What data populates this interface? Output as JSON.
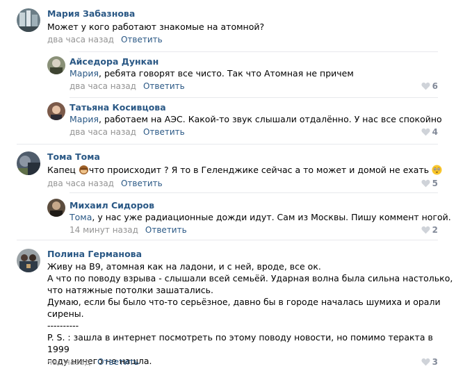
{
  "reply_label": "Ответить",
  "comments": [
    {
      "author": "Мария Забазнова",
      "text": "Может у кого работают знакомые на атомной?",
      "time": "два часа назад"
    },
    {
      "author": "Айседора Дункан",
      "mention": "Мария",
      "text": ", ребята говорят все чисто. Так что Атомная не причем",
      "time": "два часа назад",
      "likes": "6"
    },
    {
      "author": "Татьяна Косивцова",
      "mention": "Мария",
      "text": ", работаем на АЭС. Какой-то звук слышали отдалённо. У нас все спокойно",
      "time": "два часа назад",
      "likes": "4"
    },
    {
      "author": "Тома Тома",
      "text_before": "Капец ",
      "text_after": "что происходит ? Я то в Геленджике сейчас а то может и домой не ехать ",
      "time": "два часа назад",
      "likes": "5"
    },
    {
      "author": "Михаил Сидоров",
      "mention": "Тома",
      "text": ", у нас уже радиационные дожди идут. Сам из Москвы. Пишу коммент ногой.",
      "time": "14 минут назад",
      "likes": "2"
    },
    {
      "author": "Полина Германова",
      "text": "Живу на В9, атомная как на ладони, и с ней, вроде, все ок.\nА что по поводу взрыва - слышали всей семьёй. Ударная волна была сильна настолько,\nчто натяжные потолки зашатались.\nДумаю, если бы было что-то серьёзное, давно бы в городе началась шумиха и орали\nсирены.\n----------\nP. S. : зашла в интернет посмотреть по этому поводу новости, но помимо теракта в 1999\nгоду ничего не нашла.",
      "time": "час назад",
      "likes": "3"
    }
  ],
  "colors": {
    "link": "#2a5885",
    "meta": "#939393",
    "divider": "#e7e8ec"
  }
}
